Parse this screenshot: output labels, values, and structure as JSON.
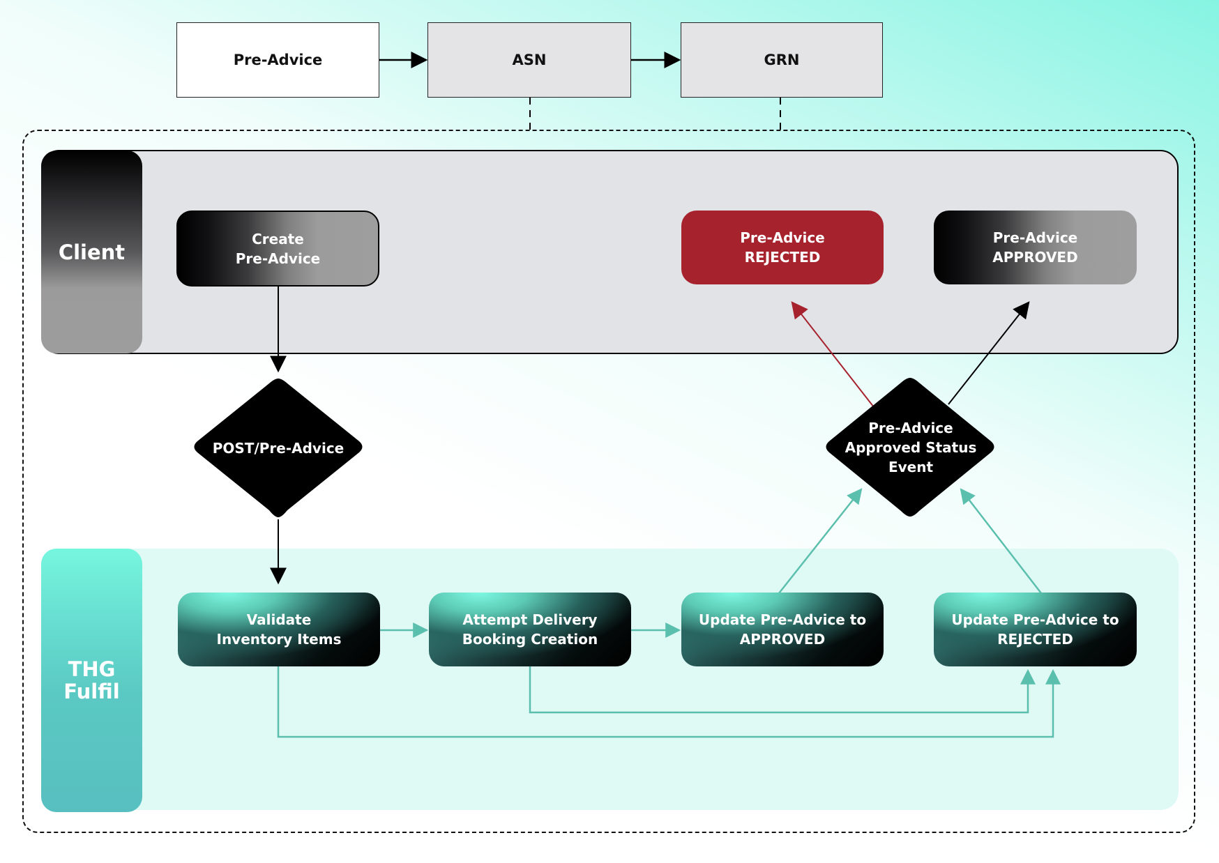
{
  "top_flow": {
    "boxes": [
      {
        "label": "Pre-Advice"
      },
      {
        "label": "ASN"
      },
      {
        "label": "GRN"
      }
    ]
  },
  "lanes": {
    "client": {
      "label": "Client"
    },
    "thg": {
      "label": "THG\nFulfil"
    }
  },
  "client_nodes": {
    "create": {
      "label": "Create\nPre-Advice"
    },
    "rejected": {
      "label": "Pre-Advice\nREJECTED"
    },
    "approved": {
      "label": "Pre-Advice\nAPPROVED"
    }
  },
  "decisions": {
    "post": {
      "label": "POST/Pre-Advice"
    },
    "event": {
      "label": "Pre-Advice\nApproved Status\nEvent"
    }
  },
  "thg_nodes": {
    "validate": {
      "label": "Validate\nInventory Items"
    },
    "attempt": {
      "label": "Attempt Delivery\nBooking Creation"
    },
    "update_approved": {
      "label": "Update Pre-Advice to\nAPPROVED"
    },
    "update_rejected": {
      "label": "Update Pre-Advice to\nREJECTED"
    }
  },
  "colors": {
    "rejected_red": "#a6222d",
    "teal_connector": "#5bbfad",
    "client_panel": "#e2e3e7",
    "thg_panel": "#dff9f5"
  }
}
